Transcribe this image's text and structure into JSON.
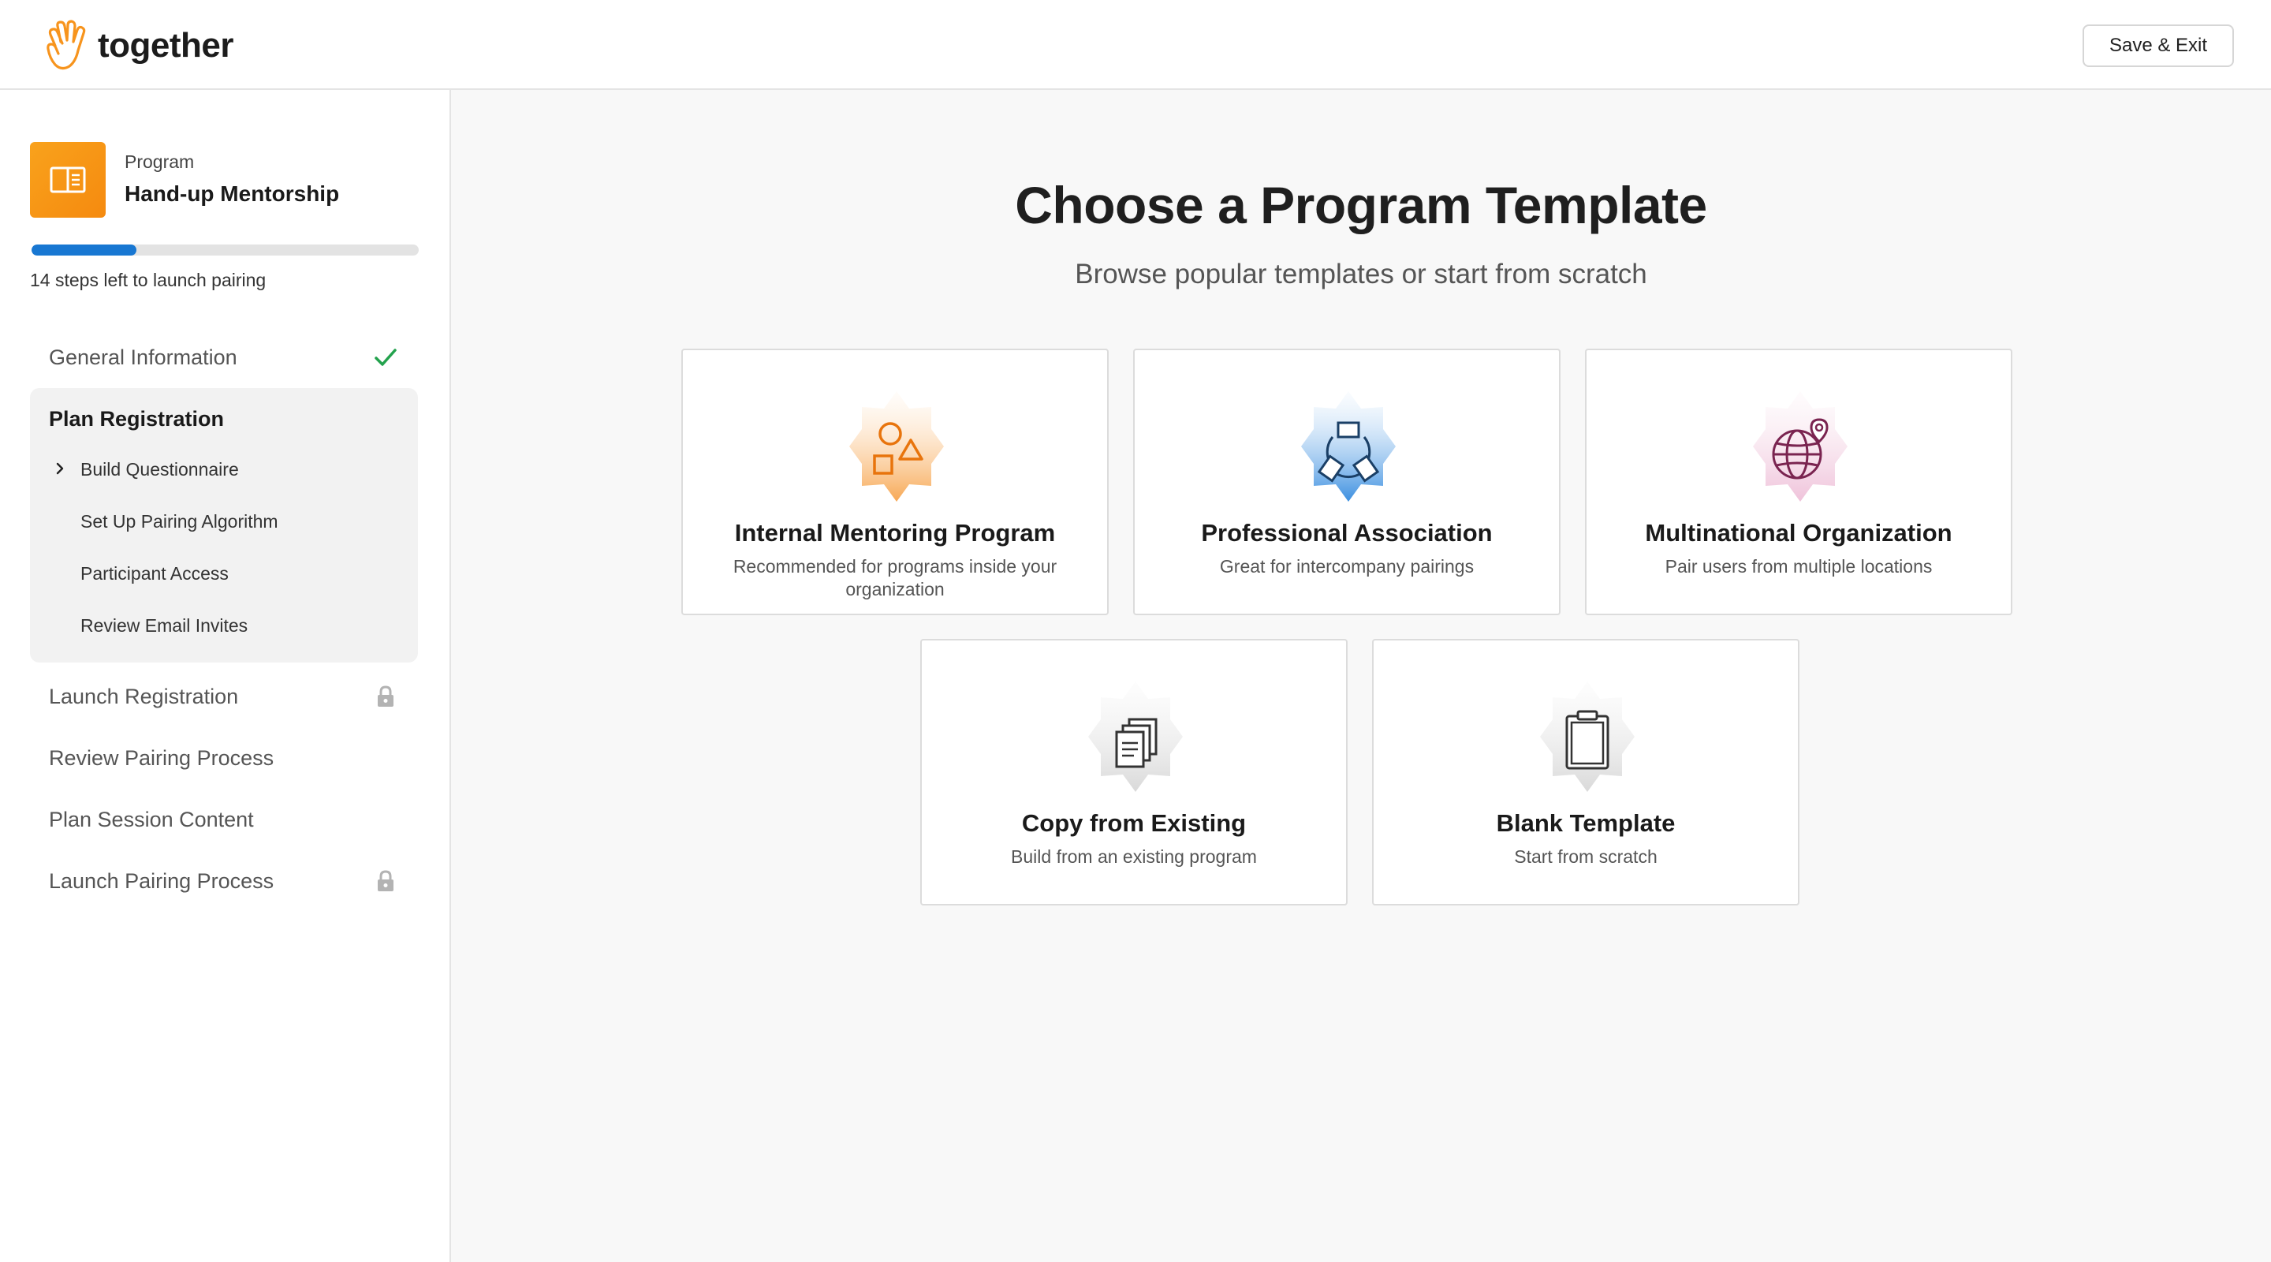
{
  "header": {
    "brand_name": "together",
    "save_exit_label": "Save & Exit"
  },
  "sidebar": {
    "program_label": "Program",
    "program_name": "Hand-up Mentorship",
    "progress_fraction": 0.27,
    "progress_text": "14 steps left to launch pairing",
    "steps": {
      "general": {
        "label": "General Information",
        "status": "complete"
      },
      "plan_registration": {
        "label": "Plan Registration",
        "sub_items": [
          "Build Questionnaire",
          "Set Up Pairing Algorithm",
          "Participant Access",
          "Review Email Invites"
        ]
      },
      "launch_registration": {
        "label": "Launch Registration",
        "status": "locked"
      },
      "review_pairing": {
        "label": "Review Pairing Process"
      },
      "plan_session": {
        "label": "Plan Session Content"
      },
      "launch_pairing": {
        "label": "Launch Pairing Process",
        "status": "locked"
      }
    }
  },
  "main": {
    "title": "Choose a Program Template",
    "subtitle": "Browse popular templates or start from scratch",
    "templates": [
      {
        "title": "Internal Mentoring Program",
        "description": "Recommended for programs inside your organization",
        "icon": "shapes-icon",
        "accent": "#f08a24"
      },
      {
        "title": "Professional Association",
        "description": "Great for intercompany pairings",
        "icon": "network-icon",
        "accent": "#2f86dd"
      },
      {
        "title": "Multinational Organization",
        "description": "Pair users from multiple locations",
        "icon": "globe-pin-icon",
        "accent": "#9b2d63"
      },
      {
        "title": "Copy from Existing",
        "description": "Build from an existing program",
        "icon": "copy-documents-icon",
        "accent": "#666666"
      },
      {
        "title": "Blank Template",
        "description": "Start from scratch",
        "icon": "clipboard-icon",
        "accent": "#666666"
      }
    ]
  },
  "colors": {
    "accent_blue": "#1877d2",
    "brand_orange": "#f7941d",
    "success_green": "#23a24d",
    "lock_gray": "#b3b3b3"
  }
}
